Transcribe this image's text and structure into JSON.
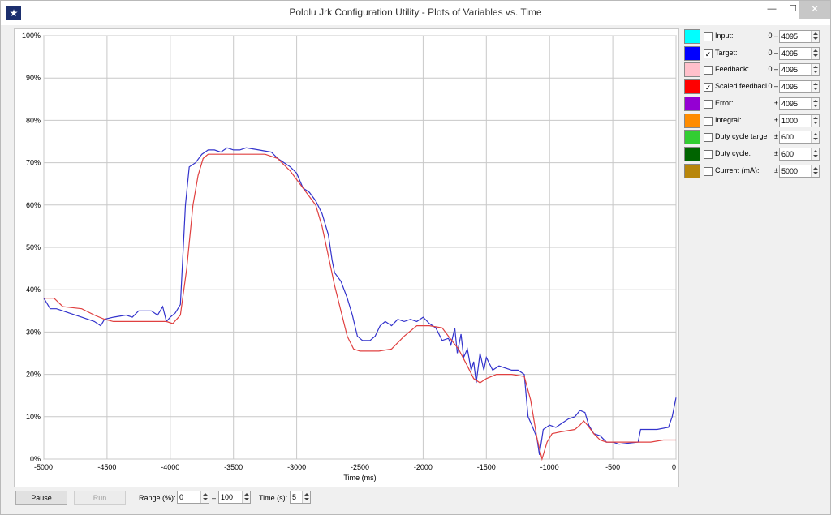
{
  "window": {
    "title": "Pololu Jrk Configuration Utility - Plots of Variables vs. Time",
    "controls": {
      "minimize": "—",
      "maximize": "☐",
      "close": "✕"
    }
  },
  "legend": [
    {
      "color": "#00ffff",
      "checked": false,
      "label": "Input:",
      "prefix": "0 –",
      "value": "4095"
    },
    {
      "color": "#0000ff",
      "checked": true,
      "label": "Target:",
      "prefix": "0 –",
      "value": "4095"
    },
    {
      "color": "#ffc0cb",
      "checked": false,
      "label": "Feedback:",
      "prefix": "0 –",
      "value": "4095"
    },
    {
      "color": "#ff0000",
      "checked": true,
      "label": "Scaled feedbacl",
      "prefix": "0 –",
      "value": "4095"
    },
    {
      "color": "#9400d3",
      "checked": false,
      "label": "Error:",
      "prefix": "±",
      "value": "4095"
    },
    {
      "color": "#ff8c00",
      "checked": false,
      "label": "Integral:",
      "prefix": "±",
      "value": "1000"
    },
    {
      "color": "#32cd32",
      "checked": false,
      "label": "Duty cycle target:",
      "prefix": "±",
      "value": "600"
    },
    {
      "color": "#006400",
      "checked": false,
      "label": "Duty cycle:",
      "prefix": "±",
      "value": "600"
    },
    {
      "color": "#b8860b",
      "checked": false,
      "label": "Current (mA):",
      "prefix": "±",
      "value": "5000"
    }
  ],
  "bottom": {
    "pause_label": "Pause",
    "run_label": "Run",
    "range_label": "Range (%):",
    "range_min": "0",
    "range_sep": "–",
    "range_max": "100",
    "time_label": "Time (s):",
    "time_value": "5"
  },
  "chart_data": {
    "type": "line",
    "xlabel": "Time (ms)",
    "ylabel": "",
    "xlim": [
      -5000,
      0
    ],
    "ylim": [
      0,
      100
    ],
    "x_ticks": [
      -5000,
      -4500,
      -4000,
      -3500,
      -3000,
      -2500,
      -2000,
      -1500,
      -1000,
      -500,
      0
    ],
    "x_tick_labels": [
      "-5000",
      "-4500",
      "-4000",
      "-3500",
      "-3000",
      "-2500",
      "-2000",
      "-1500",
      "-1000",
      "-500",
      "0"
    ],
    "y_ticks": [
      0,
      10,
      20,
      30,
      40,
      50,
      60,
      70,
      80,
      90,
      100
    ],
    "y_tick_labels": [
      "0%",
      "10%",
      "20%",
      "30%",
      "40%",
      "50%",
      "60%",
      "70%",
      "80%",
      "90%",
      "100%"
    ],
    "grid": true,
    "series": [
      {
        "color": "#3333cc",
        "points": [
          [
            -5000,
            38
          ],
          [
            -4950,
            35.5
          ],
          [
            -4900,
            35.5
          ],
          [
            -4800,
            34.5
          ],
          [
            -4700,
            33.5
          ],
          [
            -4600,
            32.5
          ],
          [
            -4550,
            31.5
          ],
          [
            -4520,
            33
          ],
          [
            -4450,
            33.5
          ],
          [
            -4350,
            34
          ],
          [
            -4300,
            33.5
          ],
          [
            -4250,
            35
          ],
          [
            -4150,
            35
          ],
          [
            -4100,
            34
          ],
          [
            -4060,
            36
          ],
          [
            -4030,
            32.5
          ],
          [
            -4000,
            33.5
          ],
          [
            -3960,
            34.5
          ],
          [
            -3920,
            36.5
          ],
          [
            -3880,
            60
          ],
          [
            -3850,
            69
          ],
          [
            -3800,
            70
          ],
          [
            -3750,
            72
          ],
          [
            -3700,
            73
          ],
          [
            -3650,
            73
          ],
          [
            -3600,
            72.5
          ],
          [
            -3550,
            73.5
          ],
          [
            -3500,
            73
          ],
          [
            -3450,
            73
          ],
          [
            -3400,
            73.5
          ],
          [
            -3300,
            73
          ],
          [
            -3200,
            72.5
          ],
          [
            -3150,
            71
          ],
          [
            -3100,
            70
          ],
          [
            -3050,
            69
          ],
          [
            -3000,
            67.5
          ],
          [
            -2950,
            64
          ],
          [
            -2900,
            63
          ],
          [
            -2850,
            61
          ],
          [
            -2800,
            58
          ],
          [
            -2750,
            53
          ],
          [
            -2720,
            47
          ],
          [
            -2700,
            44
          ],
          [
            -2650,
            42
          ],
          [
            -2600,
            38
          ],
          [
            -2560,
            34
          ],
          [
            -2520,
            29
          ],
          [
            -2480,
            28
          ],
          [
            -2420,
            28
          ],
          [
            -2380,
            29
          ],
          [
            -2340,
            31.5
          ],
          [
            -2300,
            32.5
          ],
          [
            -2250,
            31.5
          ],
          [
            -2200,
            33
          ],
          [
            -2150,
            32.5
          ],
          [
            -2100,
            33
          ],
          [
            -2050,
            32.5
          ],
          [
            -2000,
            33.5
          ],
          [
            -1950,
            32
          ],
          [
            -1900,
            31
          ],
          [
            -1850,
            28
          ],
          [
            -1800,
            28.5
          ],
          [
            -1780,
            27
          ],
          [
            -1750,
            31
          ],
          [
            -1730,
            25
          ],
          [
            -1700,
            29.5
          ],
          [
            -1680,
            24
          ],
          [
            -1650,
            26
          ],
          [
            -1620,
            21
          ],
          [
            -1600,
            23
          ],
          [
            -1580,
            18
          ],
          [
            -1550,
            25
          ],
          [
            -1520,
            21
          ],
          [
            -1500,
            24
          ],
          [
            -1450,
            21
          ],
          [
            -1400,
            22
          ],
          [
            -1300,
            21
          ],
          [
            -1250,
            21
          ],
          [
            -1200,
            20
          ],
          [
            -1170,
            10
          ],
          [
            -1140,
            8
          ],
          [
            -1100,
            5
          ],
          [
            -1080,
            1
          ],
          [
            -1050,
            7
          ],
          [
            -1000,
            8
          ],
          [
            -950,
            7.5
          ],
          [
            -900,
            8.5
          ],
          [
            -850,
            9.5
          ],
          [
            -800,
            10
          ],
          [
            -760,
            11.5
          ],
          [
            -720,
            11
          ],
          [
            -690,
            8
          ],
          [
            -650,
            6
          ],
          [
            -600,
            5.5
          ],
          [
            -550,
            4
          ],
          [
            -500,
            4
          ],
          [
            -450,
            3.5
          ],
          [
            -300,
            4
          ],
          [
            -280,
            7
          ],
          [
            -150,
            7
          ],
          [
            -60,
            7.5
          ],
          [
            -30,
            10
          ],
          [
            0,
            14.5
          ]
        ]
      },
      {
        "color": "#e04040",
        "points": [
          [
            -5000,
            38
          ],
          [
            -4920,
            38
          ],
          [
            -4850,
            36
          ],
          [
            -4700,
            35.5
          ],
          [
            -4600,
            34
          ],
          [
            -4520,
            33
          ],
          [
            -4450,
            32.5
          ],
          [
            -4300,
            32.5
          ],
          [
            -4100,
            32.5
          ],
          [
            -4030,
            32.5
          ],
          [
            -3980,
            32
          ],
          [
            -3920,
            34
          ],
          [
            -3870,
            45
          ],
          [
            -3820,
            60
          ],
          [
            -3780,
            67
          ],
          [
            -3740,
            71
          ],
          [
            -3700,
            72
          ],
          [
            -3600,
            72
          ],
          [
            -3400,
            72
          ],
          [
            -3250,
            72
          ],
          [
            -3150,
            71
          ],
          [
            -3050,
            68
          ],
          [
            -2950,
            64
          ],
          [
            -2850,
            60
          ],
          [
            -2800,
            55
          ],
          [
            -2750,
            48
          ],
          [
            -2700,
            41
          ],
          [
            -2650,
            35
          ],
          [
            -2600,
            29
          ],
          [
            -2550,
            26
          ],
          [
            -2500,
            25.5
          ],
          [
            -2350,
            25.5
          ],
          [
            -2250,
            26
          ],
          [
            -2150,
            29
          ],
          [
            -2050,
            31.5
          ],
          [
            -1950,
            31.5
          ],
          [
            -1850,
            31
          ],
          [
            -1800,
            29
          ],
          [
            -1720,
            26
          ],
          [
            -1650,
            22
          ],
          [
            -1600,
            19
          ],
          [
            -1550,
            18
          ],
          [
            -1500,
            19
          ],
          [
            -1420,
            20
          ],
          [
            -1300,
            20
          ],
          [
            -1200,
            19.5
          ],
          [
            -1150,
            14
          ],
          [
            -1100,
            5
          ],
          [
            -1060,
            0
          ],
          [
            -1020,
            4
          ],
          [
            -980,
            6
          ],
          [
            -900,
            6.5
          ],
          [
            -800,
            7
          ],
          [
            -760,
            8
          ],
          [
            -730,
            9
          ],
          [
            -700,
            8
          ],
          [
            -650,
            6
          ],
          [
            -600,
            4.5
          ],
          [
            -550,
            4
          ],
          [
            -450,
            4
          ],
          [
            -300,
            4
          ],
          [
            -200,
            4
          ],
          [
            -100,
            4.5
          ],
          [
            0,
            4.5
          ]
        ]
      }
    ]
  }
}
